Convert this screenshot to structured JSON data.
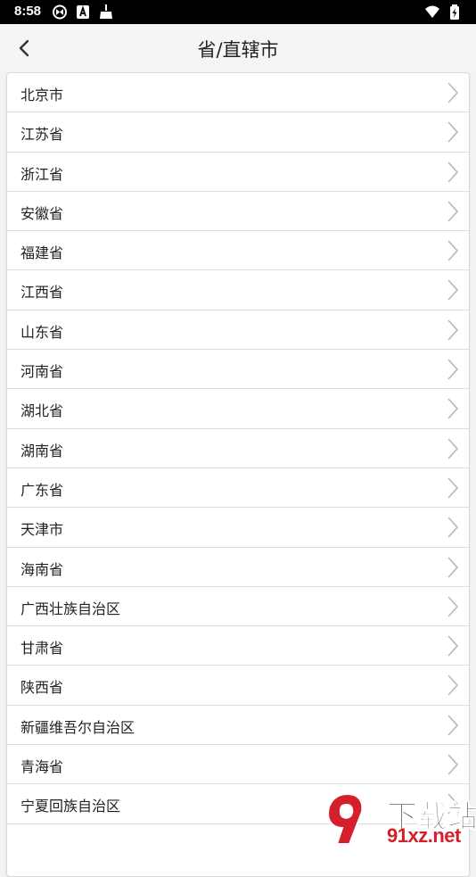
{
  "status_bar": {
    "time": "8:58",
    "left_icons": [
      "sync-icon",
      "a-app-icon",
      "broom-icon"
    ],
    "right_icons": [
      "wifi-icon",
      "battery-charging-icon"
    ]
  },
  "header": {
    "title": "省/直辖市",
    "back_icon": "chevron-left-icon"
  },
  "provinces": [
    "北京市",
    "江苏省",
    "浙江省",
    "安徽省",
    "福建省",
    "江西省",
    "山东省",
    "河南省",
    "湖北省",
    "湖南省",
    "广东省",
    "天津市",
    "海南省",
    "广西壮族自治区",
    "甘肃省",
    "陕西省",
    "新疆维吾尔自治区",
    "青海省",
    "宁夏回族自治区"
  ],
  "item_icon": "chevron-right-icon",
  "watermark": {
    "top": "下载站",
    "bottom": "91xz.net",
    "accent_color": "#d4202a"
  }
}
